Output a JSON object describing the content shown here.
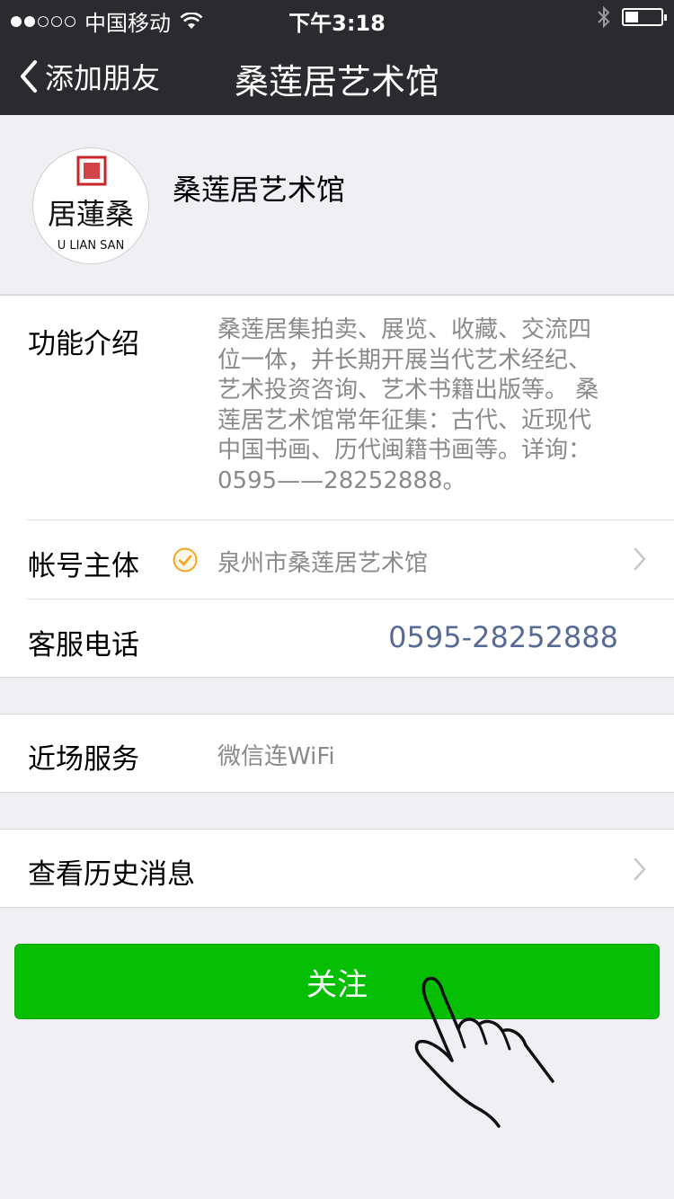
{
  "status": {
    "carrier": "中国移动",
    "time": "下午3:18"
  },
  "nav": {
    "back_label": "添加朋友",
    "title": "桑莲居艺术馆"
  },
  "profile": {
    "name": "桑莲居艺术馆",
    "avatar_text": "居蓮桑",
    "avatar_caption": "U LIAN SAN"
  },
  "info": {
    "intro_label": "功能介绍",
    "intro_lines": [
      "桑莲居集拍卖、展览、收藏、交流四",
      "位一体，并长期开展当代艺术经纪、",
      "艺术投资咨询、艺术书籍出版等。 桑",
      "莲居艺术馆常年征集：古代、近现代",
      "中国书画、历代闽籍书画等。详询：",
      "0595——28252888。"
    ],
    "account_label": "帐号主体",
    "account_value": "泉州市桑莲居艺术馆",
    "phone_label": "客服电话",
    "phone_value": "0595-28252888"
  },
  "nearby": {
    "label": "近场服务",
    "value": "微信连WiFi"
  },
  "history": {
    "label": "查看历史消息"
  },
  "follow": {
    "label": "关注"
  },
  "colors": {
    "nav_bg": "#2b2b2f",
    "page_bg": "#efeff4",
    "button_green": "#06bf04",
    "link_blue": "#576b95",
    "verify_orange": "#f5a623"
  }
}
